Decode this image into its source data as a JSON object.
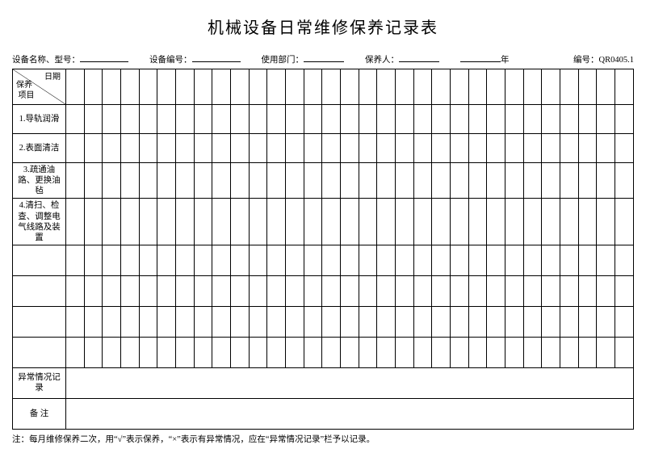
{
  "title": "机械设备日常维修保养记录表",
  "header": {
    "device_name_label": "设备名称、型号：",
    "device_no_label": "设备编号：",
    "dept_label": "使用部门：",
    "maintainer_label": "保养人：",
    "year_suffix": "年",
    "form_no_label": "编号：",
    "form_no_value": "QR0405.1"
  },
  "diag": {
    "date": "日期",
    "item_line1": "保养",
    "item_line2": "项目"
  },
  "rows": [
    "1.导轨润滑",
    "2.表面清洁",
    "3.疏通油路、更换油毡",
    "4.清扫、检查、调整电气线路及装置"
  ],
  "abnormal_label": "异常情况记录",
  "remark_label": "备 注",
  "footnote": "注：每月维修保养二次，用“√”表示保养，“×”表示有异常情况，应在“异常情况记录”栏予以记录。",
  "chart_data": {
    "type": "table",
    "title": "机械设备日常维修保养记录表",
    "columns_header_split": {
      "left_bottom": "保养项目",
      "right_top": "日期"
    },
    "day_columns": 31,
    "row_labels": [
      "1.导轨润滑",
      "2.表面清洁",
      "3.疏通油路、更换油毡",
      "4.清扫、检查、调整电气线路及装置",
      "",
      "",
      "",
      "",
      "异常情况记录",
      "备 注"
    ],
    "legend": {
      "√": "保养",
      "×": "有异常情况"
    },
    "values": []
  }
}
